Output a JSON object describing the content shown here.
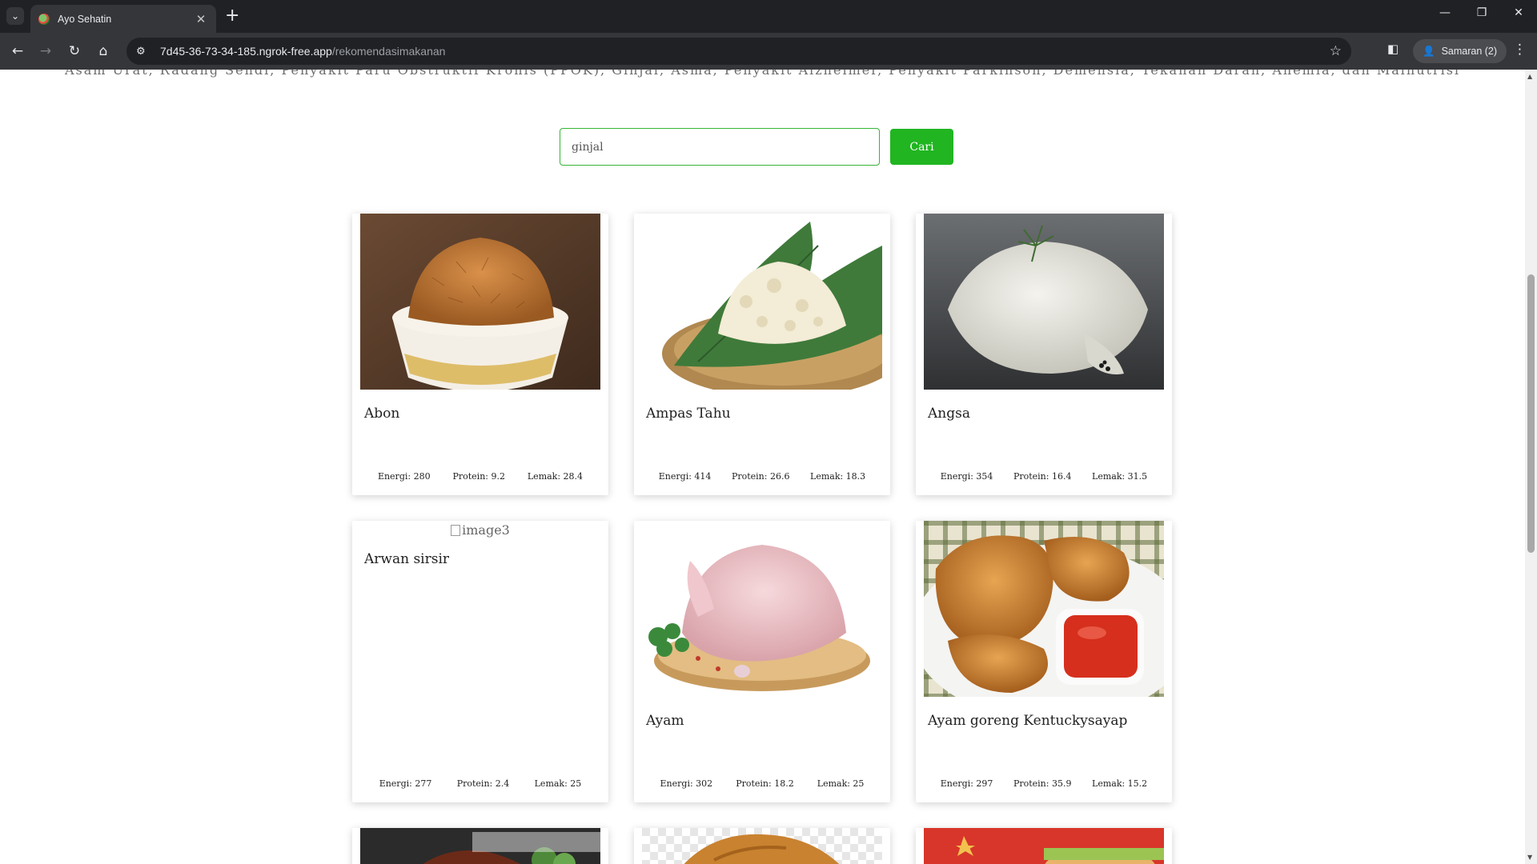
{
  "browser": {
    "tab_title": "Ayo Sehatin",
    "tab_close": "✕",
    "new_tab": "+",
    "url_host": "7d45-36-73-34-185.ngrok-free.app",
    "url_path": "/rekomendasimakanan",
    "profile_label": "Samaran (2)",
    "icons": [
      "chevron-down-icon",
      "back-icon",
      "forward-icon",
      "reload-icon",
      "home-icon",
      "site-info-icon",
      "star-icon",
      "side-panel-icon",
      "incognito-icon",
      "kebab-menu-icon",
      "minimize-icon",
      "restore-icon",
      "close-icon"
    ]
  },
  "page": {
    "disease_list": "Asam Urat, Radang Sendi, Penyakit Paru Obstruktif Kronis (PPOK), Ginjal, Asma, Penyakit Alzheimer, Penyakit Parkinson, Demensia, Tekanan Darah, Anemia, dan Malnutrisi",
    "search": {
      "value": "ginjal",
      "placeholder": "ginjal",
      "button": "Cari"
    }
  },
  "foods": [
    {
      "name": "Abon",
      "energi": "Energi: 280",
      "protein": "Protein: 9.2",
      "lemak": "Lemak: 28.4"
    },
    {
      "name": "Ampas Tahu",
      "energi": "Energi: 414",
      "protein": "Protein: 26.6",
      "lemak": "Lemak: 18.3"
    },
    {
      "name": "Angsa",
      "energi": "Energi: 354",
      "protein": "Protein: 16.4",
      "lemak": "Lemak: 31.5"
    },
    {
      "name": "Arwan sirsir",
      "image_alt": "image3",
      "energi": "Energi: 277",
      "protein": "Protein: 2.4",
      "lemak": "Lemak: 25"
    },
    {
      "name": "Ayam",
      "energi": "Energi: 302",
      "protein": "Protein: 18.2",
      "lemak": "Lemak: 25"
    },
    {
      "name": "Ayam goreng Kentuckysayap",
      "energi": "Energi: 297",
      "protein": "Protein: 35.9",
      "lemak": "Lemak: 15.2"
    }
  ],
  "colors": {
    "accent_green": "#21b521",
    "chrome_dark": "#202124",
    "chrome_toolbar": "#35363a"
  }
}
